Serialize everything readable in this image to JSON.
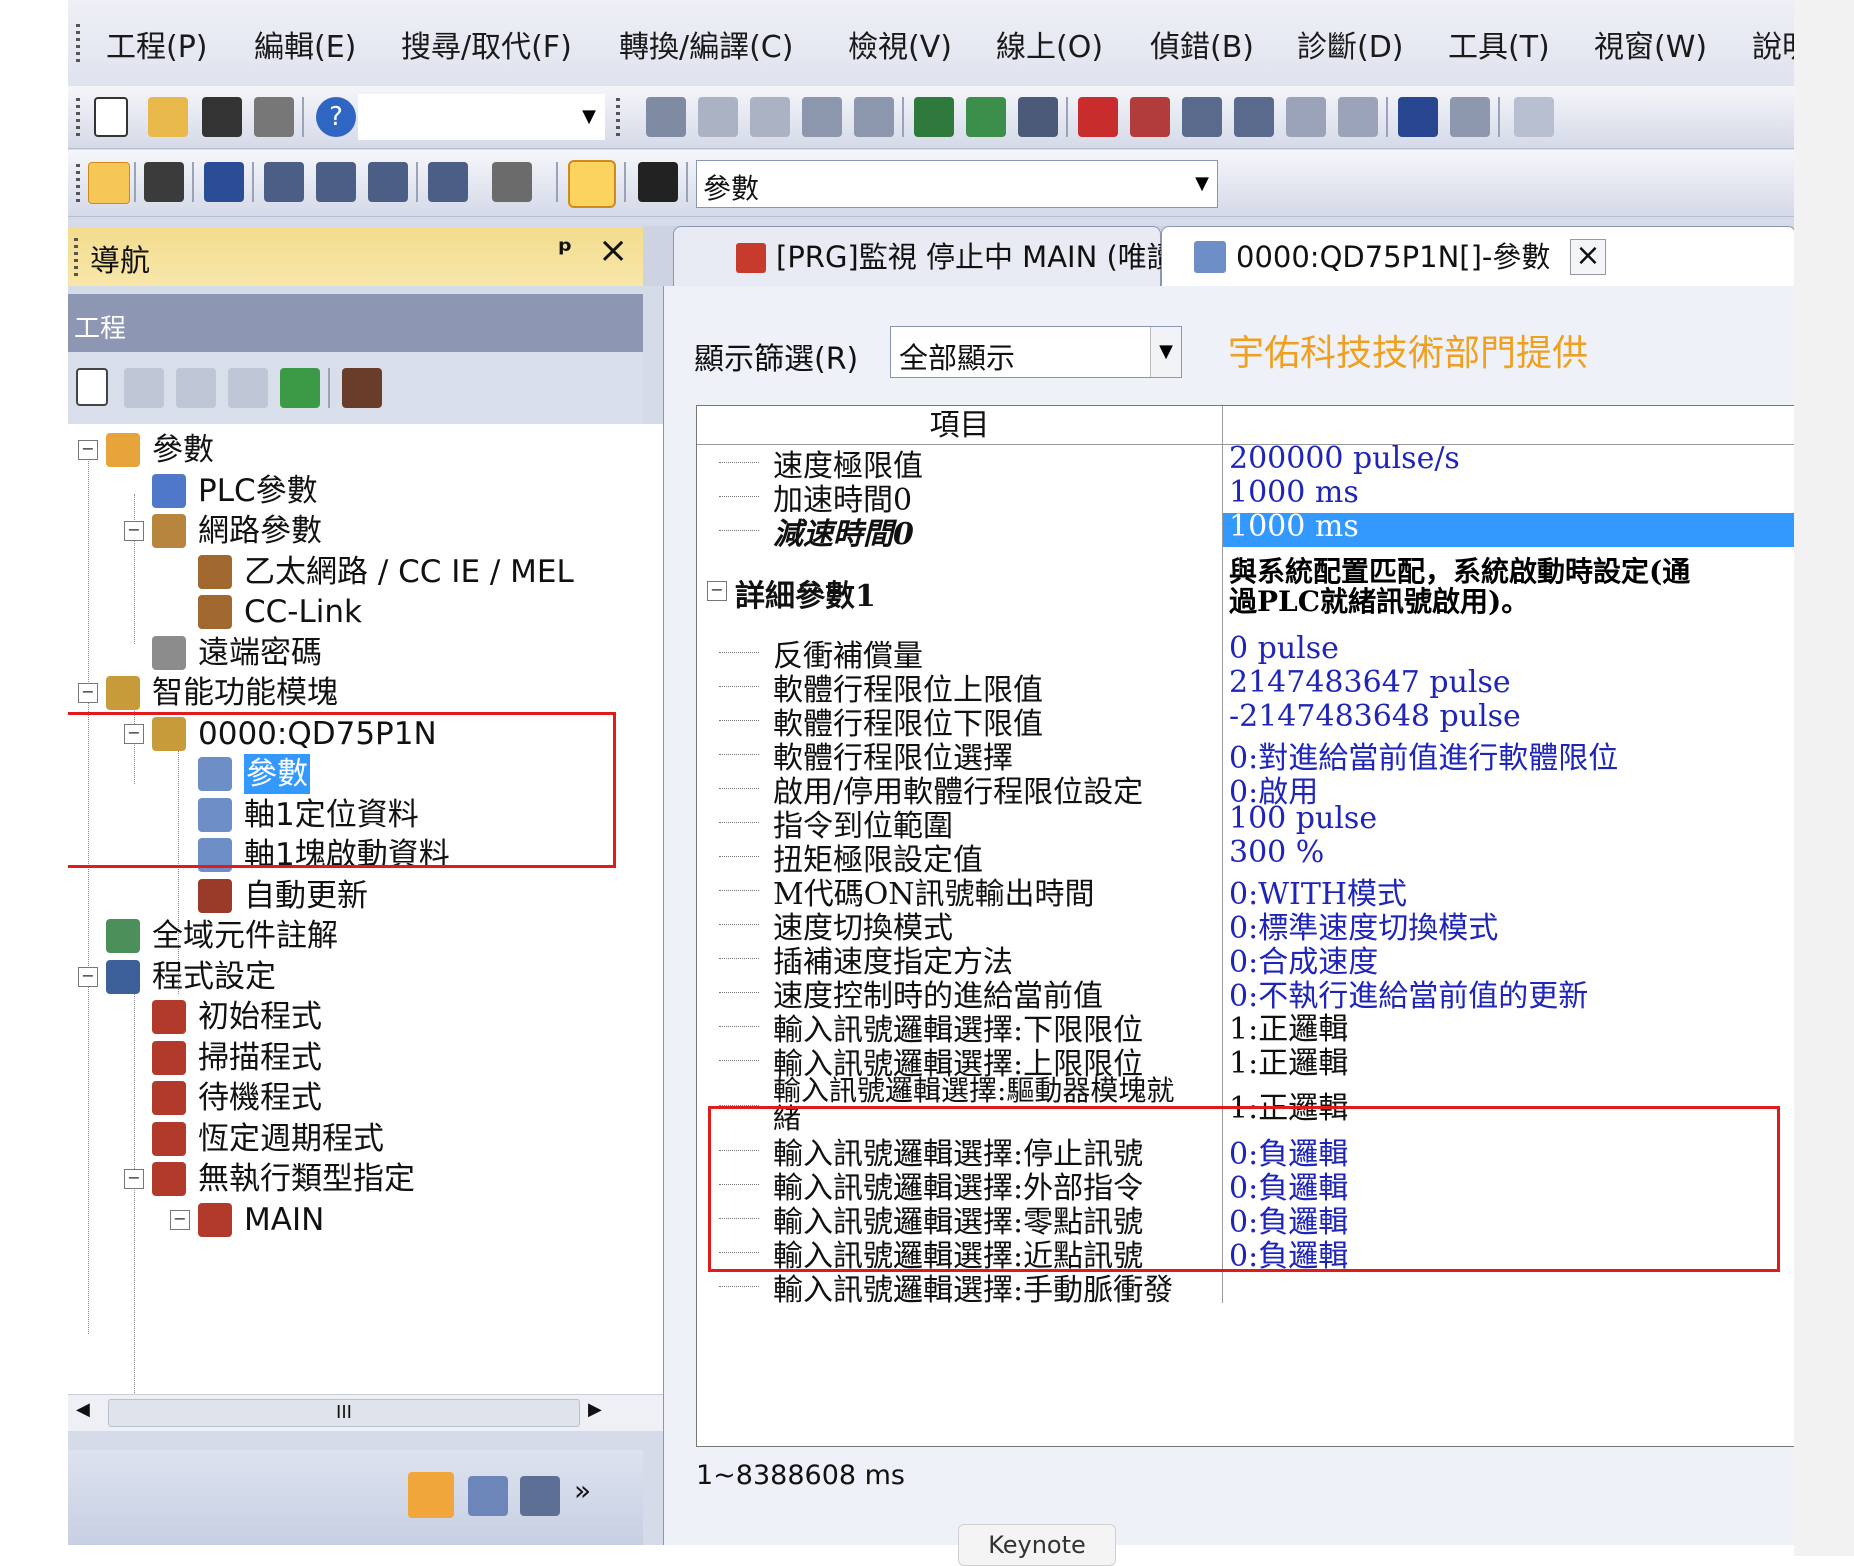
{
  "menu": [
    "工程(P)",
    "編輯(E)",
    "搜尋/取代(F)",
    "轉換/編譯(C)",
    "檢視(V)",
    "線上(O)",
    "偵錯(B)",
    "診斷(D)",
    "工具(T)",
    "視窗(W)",
    "說明"
  ],
  "toolbar3": {
    "combo_value": "參數"
  },
  "nav": {
    "title": "導航",
    "pin": "ᵖ",
    "close": "×",
    "section": "工程",
    "tree": [
      {
        "label": "參數",
        "expander": "−"
      },
      {
        "label": "PLC參數"
      },
      {
        "label": "網路參數",
        "expander": "−"
      },
      {
        "label": "乙太網路 / CC IE / MEL"
      },
      {
        "label": "CC-Link"
      },
      {
        "label": "遠端密碼"
      },
      {
        "label": "智能功能模塊",
        "expander": "−"
      },
      {
        "label": "0000:QD75P1N",
        "expander": "−"
      },
      {
        "label": "參數",
        "selected": true
      },
      {
        "label": "軸1定位資料"
      },
      {
        "label": "軸1塊啟動資料"
      },
      {
        "label": "自動更新"
      },
      {
        "label": "全域元件註解"
      },
      {
        "label": "程式設定",
        "expander": "−"
      },
      {
        "label": "初始程式"
      },
      {
        "label": "掃描程式"
      },
      {
        "label": "待機程式"
      },
      {
        "label": "恆定週期程式"
      },
      {
        "label": "無執行類型指定",
        "expander": "−"
      },
      {
        "label": "MAIN",
        "expander": "−"
      }
    ],
    "hscroll_grip": "III"
  },
  "tabs": [
    {
      "label": "[PRG]監視 停止中 MAIN (唯讀) ..."
    },
    {
      "label": "0000:QD75P1N[]-參數",
      "close": "×"
    }
  ],
  "editor": {
    "filter_label": "顯示篩選(R)",
    "filter_value": "全部顯示",
    "watermark": "宇佑科技技術部門提供",
    "watermark_color": "#f0a020",
    "column_item": "項目",
    "rows": [
      {
        "item": "速度極限值",
        "value": "200000 pulse/s"
      },
      {
        "item": "加速時間0",
        "value": "1000 ms"
      },
      {
        "item": "減速時間0",
        "value": "1000 ms"
      },
      {
        "item": "詳細參數1",
        "value": "與系統配置匹配，系統啟動時設定(通過PLC就緒訊號啟用)。"
      },
      {
        "item": "反衝補償量",
        "value": "0 pulse"
      },
      {
        "item": "軟體行程限位上限值",
        "value": "2147483647 pulse"
      },
      {
        "item": "軟體行程限位下限值",
        "value": "-2147483648 pulse"
      },
      {
        "item": "軟體行程限位選擇",
        "value": "0:對進給當前值進行軟體限位"
      },
      {
        "item": "啟用/停用軟體行程限位設定",
        "value": "0:啟用"
      },
      {
        "item": "指令到位範圍",
        "value": "100 pulse"
      },
      {
        "item": "扭矩極限設定值",
        "value": "300 %"
      },
      {
        "item": "M代碼ON訊號輸出時間",
        "value": "0:WITH模式"
      },
      {
        "item": "速度切換模式",
        "value": "0:標準速度切換模式"
      },
      {
        "item": "插補速度指定方法",
        "value": "0:合成速度"
      },
      {
        "item": "速度控制時的進給當前值",
        "value": "0:不執行進給當前值的更新"
      },
      {
        "item": "輸入訊號邏輯選擇:下限限位",
        "value": "1:正邏輯"
      },
      {
        "item": "輸入訊號邏輯選擇:上限限位",
        "value": "1:正邏輯"
      },
      {
        "item": "輸入訊號邏輯選擇:驅動器模塊就緒",
        "value": "1:正邏輯"
      },
      {
        "item": "輸入訊號邏輯選擇:停止訊號",
        "value": "0:負邏輯"
      },
      {
        "item": "輸入訊號邏輯選擇:外部指令",
        "value": "0:負邏輯"
      },
      {
        "item": "輸入訊號邏輯選擇:零點訊號",
        "value": "0:負邏輯"
      },
      {
        "item": "輸入訊號邏輯選擇:近點訊號",
        "value": "0:負邏輯"
      },
      {
        "item": "輸入訊號邏輯選擇:手動脈衝發",
        "value": ""
      }
    ],
    "status_range": "1~8388608 ms"
  },
  "tooltip": "Keynote",
  "colors": {
    "highlight": "#3399ff",
    "value_text": "#1f25b8",
    "annotation_red": "#e11b1b"
  }
}
